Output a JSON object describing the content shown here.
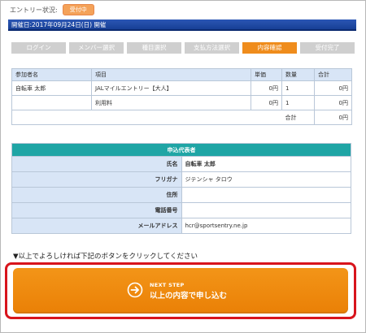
{
  "entry_status": {
    "label": "エントリー状況:",
    "badge": "受付中"
  },
  "event_date": "開催日:2017年09月24日(日) 開催",
  "steps": [
    "ログイン",
    "メンバー選択",
    "種目選択",
    "支払方法選択",
    "内容確認",
    "受付完了"
  ],
  "active_step": 4,
  "order": {
    "headers": [
      "参加者名",
      "項目",
      "単価",
      "数量",
      "合計"
    ],
    "rows": [
      {
        "participant": "自転車 太郎",
        "item": "JALマイルエントリー【大人】",
        "unit_price": "0円",
        "qty": "1",
        "total": "0円"
      },
      {
        "participant": "",
        "item": "利用料",
        "unit_price": "0円",
        "qty": "1",
        "total": "0円"
      }
    ],
    "summary_label": "合計",
    "summary_total": "0円"
  },
  "representative": {
    "title": "申込代表者",
    "rows": [
      {
        "label": "氏名",
        "value": "自転車 太郎"
      },
      {
        "label": "フリガナ",
        "value": "ジテンシャ タロウ"
      },
      {
        "label": "住所",
        "value": ""
      },
      {
        "label": "電話番号",
        "value": ""
      },
      {
        "label": "メールアドレス",
        "value": "hcr@sportsentry.ne.jp"
      }
    ]
  },
  "instruction": "▼以上でよろしければ下記のボタンをクリックしてください",
  "next_button": {
    "sub": "NEXT STEP",
    "main": "以上の内容で申し込む",
    "icon": "arrow-right-circle-icon"
  },
  "colors": {
    "active_step": "#ef8c1c",
    "date_bar": "#1f4aa8",
    "rep_header": "#1fa5a5",
    "button": "#ef8a10",
    "highlight_outline": "#d8141c"
  }
}
